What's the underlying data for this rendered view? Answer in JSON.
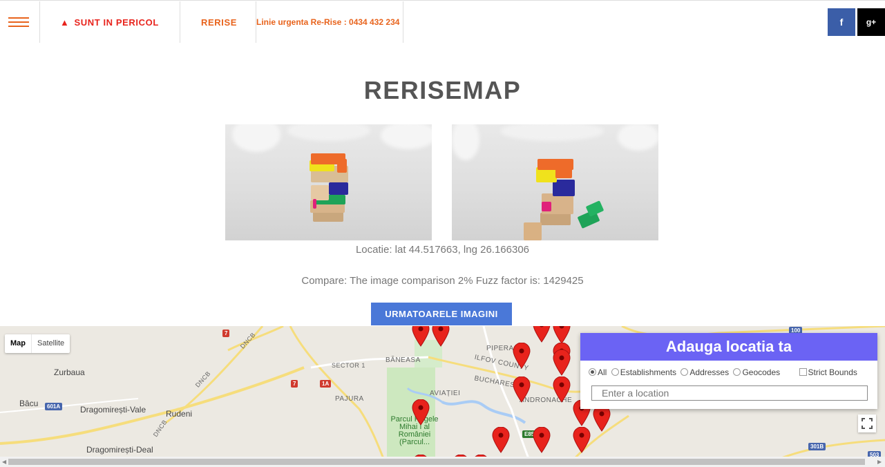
{
  "nav": {
    "danger_label": "SUNT IN PERICOL",
    "rerise_label": "RERISE",
    "hotline": "Linie urgenta Re-Rise : 0434 432 234",
    "facebook": "f",
    "googleplus": "g+"
  },
  "page": {
    "title": "RERISEMAP",
    "location": "Locatie: lat 44.517663, lng 26.166306",
    "compare": "Compare: The image comparison 2% Fuzz factor is: 1429425",
    "next_button": "URMATOARELE IMAGINI"
  },
  "map": {
    "type_map": "Map",
    "type_satellite": "Satellite",
    "labels": {
      "zurbaua": "Zurbaua",
      "bacu": "Bâcu",
      "dragomiresti_vale": "Dragomirești-Vale",
      "rudeni": "Rudeni",
      "dragomiresti_deal": "Dragomirești-Deal",
      "sector1": "SECTOR 1",
      "baneasa": "BĂNEASA",
      "pajura": "PAJURA",
      "aviatiei": "AVIAȚIEI",
      "pipera": "PIPERA",
      "ilfov": "ILFOV COUNTY",
      "bucharest": "BUCHAREST",
      "andronache": "ANDRONACHE",
      "park": "Parcul Regele\nMihai I al\nRomâniei\n(Parcul...",
      "dncb1": "DNCB",
      "dncb2": "DNCB",
      "dncb3": "DNCB"
    },
    "shields": {
      "r7a": "7",
      "r7b": "7",
      "r1a": "1A",
      "r601a": "601A",
      "r100": "100",
      "r85": "E85",
      "r301b": "301B",
      "r503": "503"
    }
  },
  "location_card": {
    "title": "Adauga locatia ta",
    "options": [
      "All",
      "Establishments",
      "Addresses",
      "Geocodes"
    ],
    "strict_bounds": "Strict Bounds",
    "input_placeholder": "Enter a location"
  },
  "colors": {
    "accent_orange": "#e8631c",
    "danger_red": "#e8231c",
    "button_blue": "#4a78d8",
    "card_purple": "#6b63f4",
    "facebook_blue": "#3b5ea8"
  }
}
